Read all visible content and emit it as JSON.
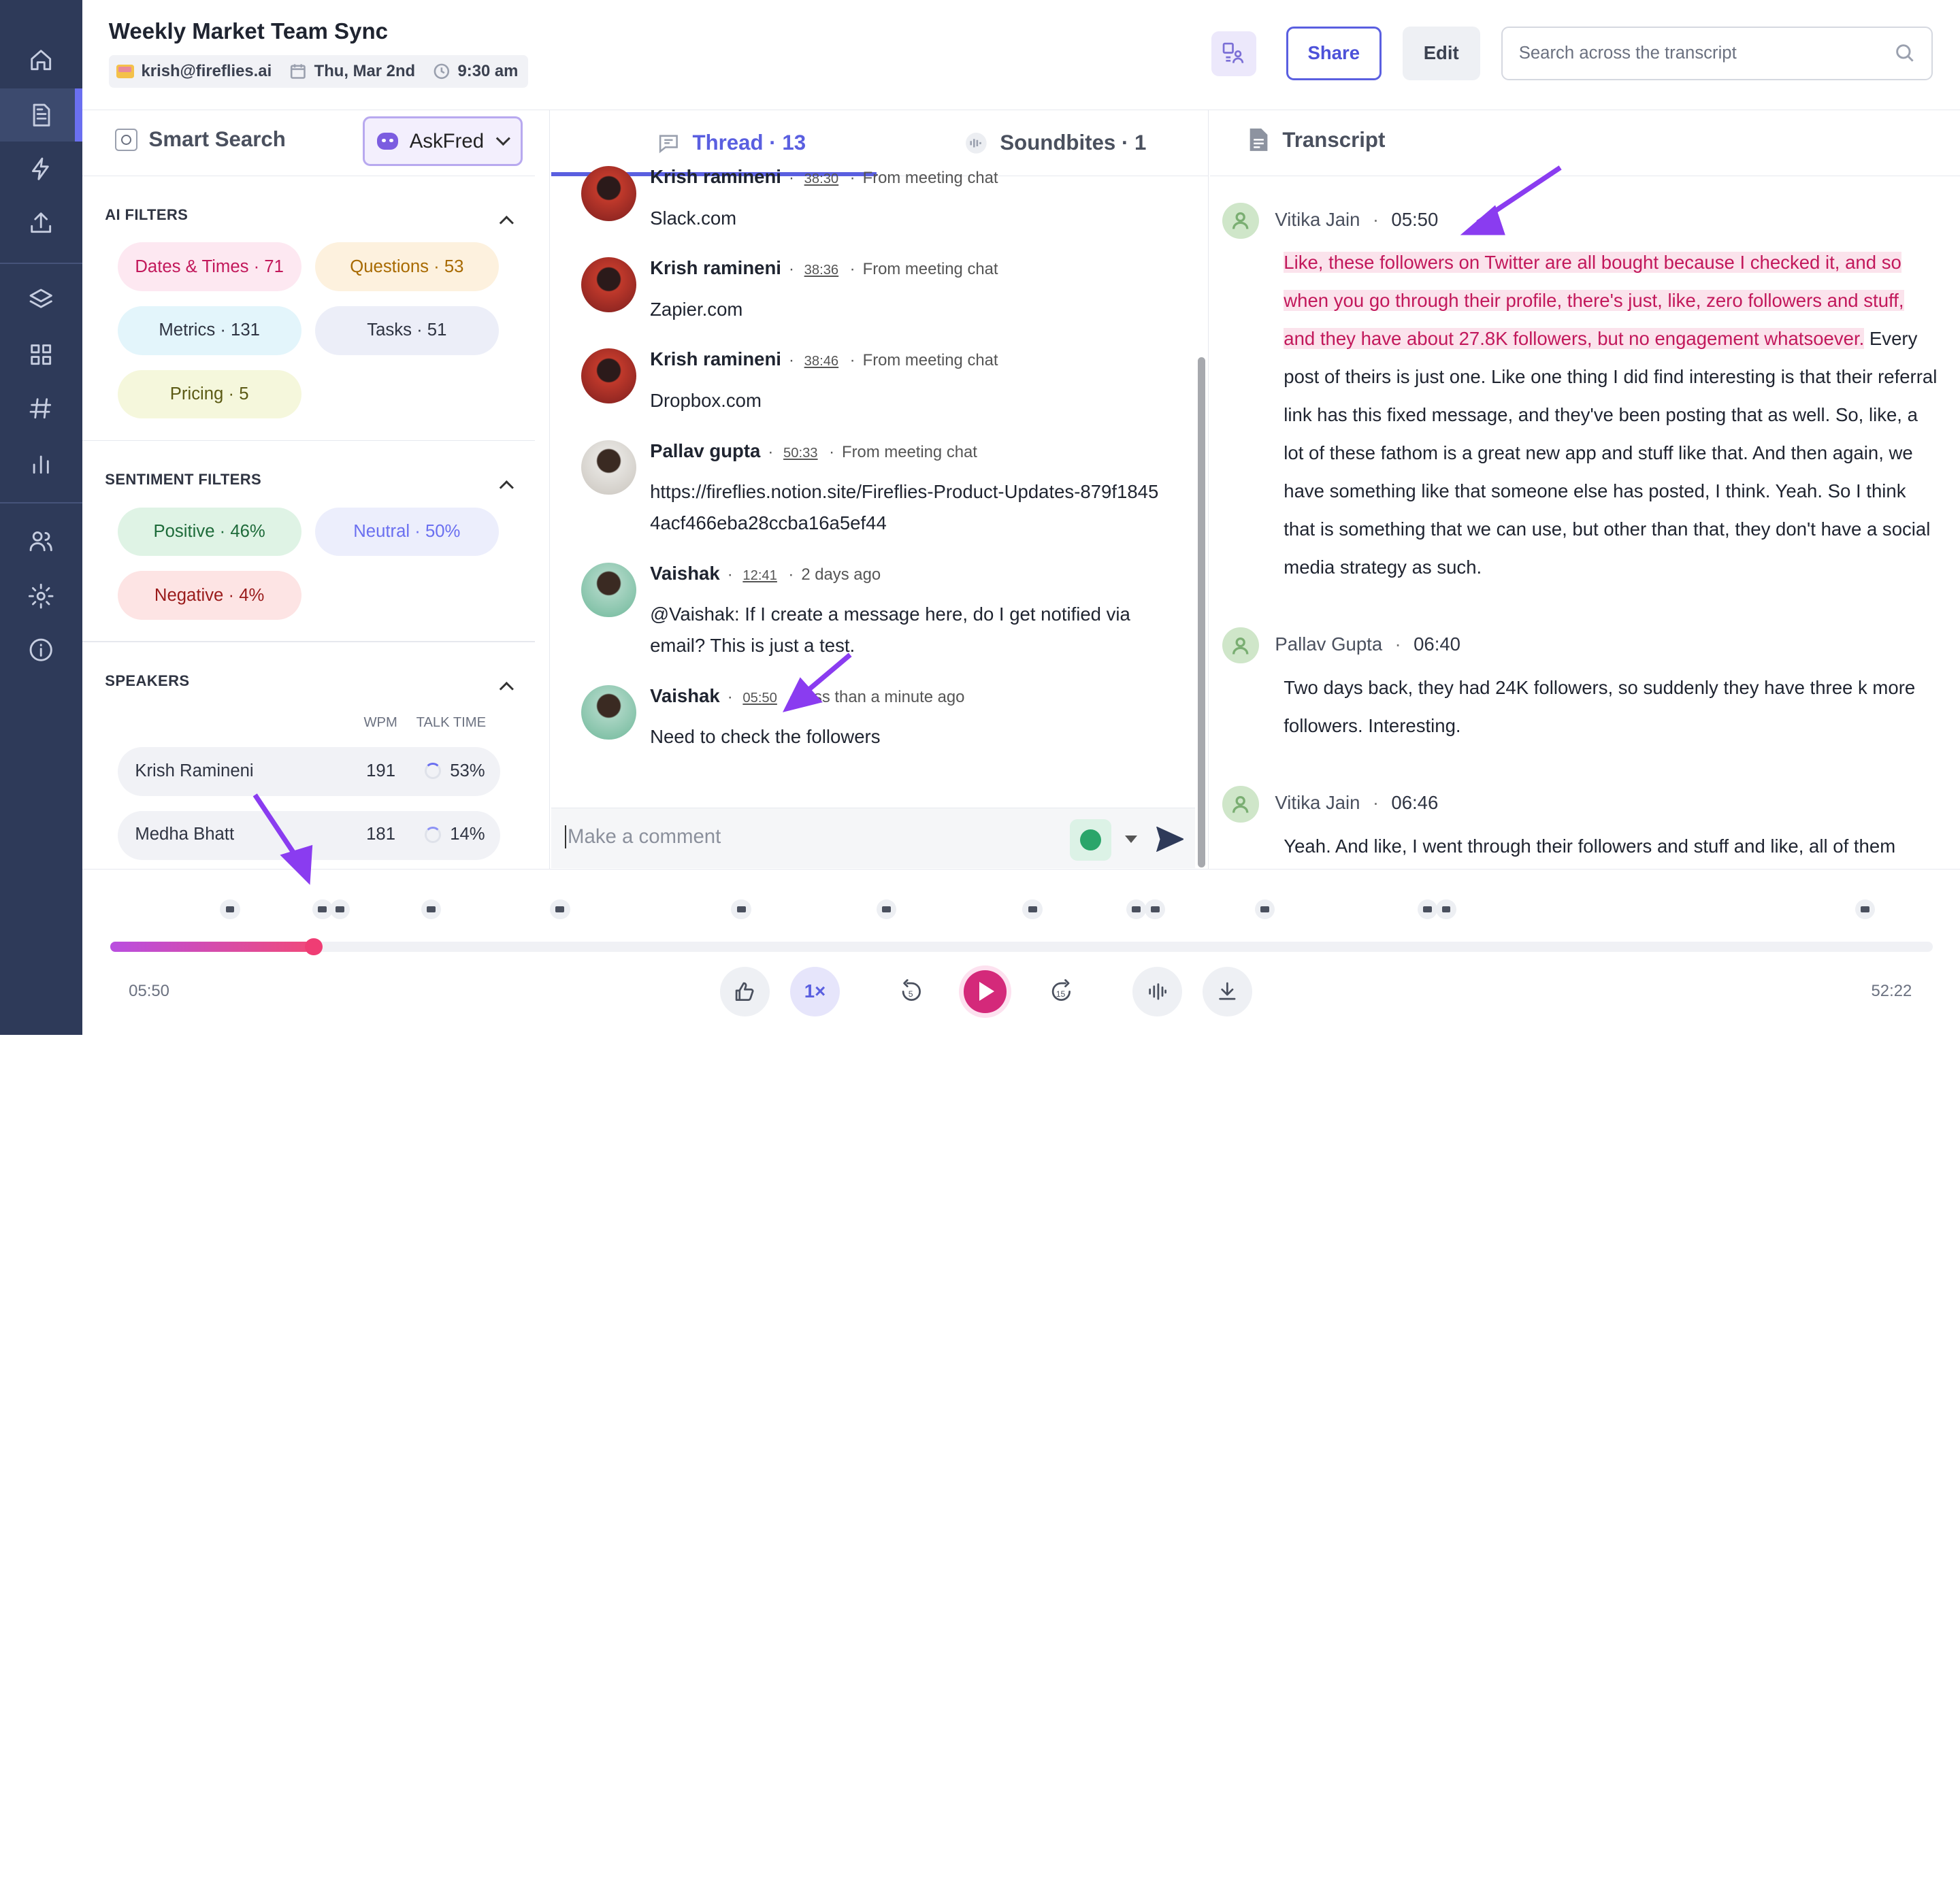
{
  "meeting": {
    "title": "Weekly Market Team Sync",
    "organizer": "krish@fireflies.ai",
    "date": "Thu, Mar 2nd",
    "time": "9:30 am"
  },
  "header": {
    "share_label": "Share",
    "edit_label": "Edit",
    "search_placeholder": "Search across the transcript"
  },
  "smart_search": {
    "title": "Smart Search",
    "askfred_label": "AskFred",
    "ai_filters_title": "AI FILTERS",
    "ai_filters": [
      {
        "label": "Dates & Times · 71",
        "color": "#c2185b",
        "bg": "#fde8f1"
      },
      {
        "label": "Questions · 53",
        "color": "#a86a00",
        "bg": "#fdf1de"
      },
      {
        "label": "Metrics · 131",
        "color": "#2f3442",
        "bg": "#e3f5fb"
      },
      {
        "label": "Tasks · 51",
        "color": "#2f3442",
        "bg": "#eceef8"
      },
      {
        "label": "Pricing · 5",
        "color": "#5b5a14",
        "bg": "#f5f7dc"
      }
    ],
    "sentiment_title": "SENTIMENT FILTERS",
    "sentiments": [
      {
        "label": "Positive · 46%",
        "color": "#1e6b3a",
        "bg": "#dff3e5"
      },
      {
        "label": "Neutral · 50%",
        "color": "#6a6ff0",
        "bg": "#eceefc"
      },
      {
        "label": "Negative · 4%",
        "color": "#9a1b1b",
        "bg": "#fde4e4"
      }
    ],
    "speakers_title": "SPEAKERS",
    "wpm_header": "WPM",
    "talk_header": "TALK TIME",
    "speakers": [
      {
        "name": "Krish Ramineni",
        "wpm": "191",
        "talk": "53%"
      },
      {
        "name": "Medha Bhatt",
        "wpm": "181",
        "talk": "14%"
      }
    ]
  },
  "tabs": {
    "thread": "Thread · 13",
    "soundbites": "Soundbites · 1"
  },
  "thread": [
    {
      "name": "Krish ramineni",
      "ts": "38:30",
      "src": "From meeting chat",
      "body": "Slack.com",
      "avatar": "red"
    },
    {
      "name": "Krish ramineni",
      "ts": "38:36",
      "src": "From meeting chat",
      "body": "Zapier.com",
      "avatar": "red"
    },
    {
      "name": "Krish ramineni",
      "ts": "38:46",
      "src": "From meeting chat",
      "body": "Dropbox.com",
      "avatar": "red"
    },
    {
      "name": "Pallav gupta",
      "ts": "50:33",
      "src": "From meeting chat",
      "body": "https://fireflies.notion.site/Fireflies-Product-Updates-879f18454acf466eba28ccba16a5ef44",
      "avatar": "gray"
    },
    {
      "name": "Vaishak",
      "ts": "12:41",
      "src": "2 days ago",
      "body": "@Vaishak: If I create a message here, do I get notified via email? This is just a test.",
      "avatar": "green"
    },
    {
      "name": "Vaishak",
      "ts": "05:50",
      "src": "less than a minute ago",
      "body": "Need to check the followers",
      "avatar": "green"
    }
  ],
  "comment": {
    "placeholder": "Make a comment"
  },
  "transcript": {
    "title": "Transcript",
    "entries": [
      {
        "speaker": "Vitika Jain",
        "time": "05:50",
        "highlight": "Like, these followers on Twitter are all bought because I checked it, and so when you go through their profile, there's just, like, zero followers and stuff, and they have about 27.8K followers, but no engagement whatsoever.",
        "text": " Every post of theirs is just one. Like one thing I did find interesting is that their referral link has this fixed message, and they've been posting that as well. So, like, a lot of these fathom is a great new app and stuff like that. And then again, we have something like that someone else has posted, I think. Yeah. So I think that is something that we can use, but other than that, they don't have a social media strategy as such."
      },
      {
        "speaker": "Pallav Gupta",
        "time": "06:40",
        "highlight": "",
        "text": "Two days back, they had 24K followers, so suddenly they have three k more followers. Interesting."
      },
      {
        "speaker": "Vitika Jain",
        "time": "06:46",
        "highlight": "",
        "text": "Yeah. And like, I went through their followers and stuff and like, all of them"
      }
    ]
  },
  "player": {
    "current_time": "05:50",
    "total_time": "52:22",
    "speed_label": "1×",
    "progress_fraction": 0.1117,
    "back_seconds": "5",
    "forward_seconds": "15"
  }
}
